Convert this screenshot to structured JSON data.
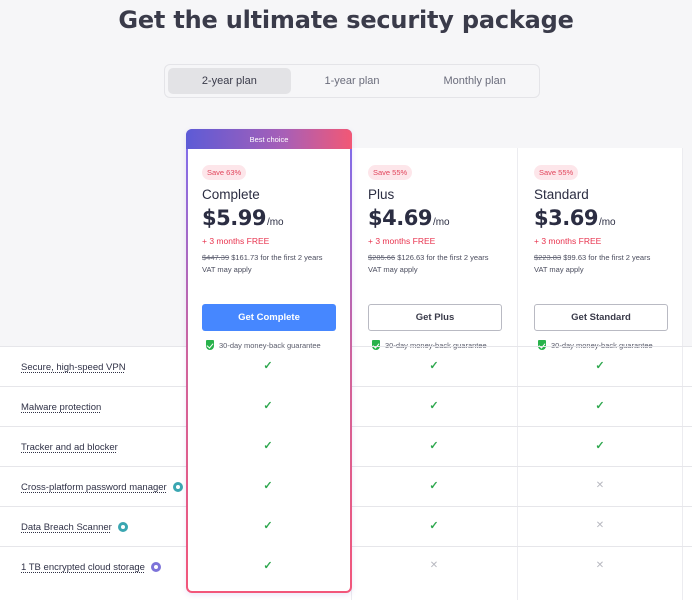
{
  "title": "Get the ultimate security package",
  "tabs": [
    {
      "label": "2-year plan",
      "active": true
    },
    {
      "label": "1-year plan",
      "active": false
    },
    {
      "label": "Monthly plan",
      "active": false
    }
  ],
  "plans": [
    {
      "banner": "Best choice",
      "save": "Save 63%",
      "name": "Complete",
      "price": "$5.99",
      "per": "/mo",
      "free": "+ 3 months FREE",
      "old_price": "$447.39",
      "new_price": "$161.73 for the first 2 years",
      "vat": "VAT may apply",
      "cta": "Get Complete",
      "guarantee": "30-day money-back guarantee"
    },
    {
      "save": "Save 55%",
      "name": "Plus",
      "price": "$4.69",
      "per": "/mo",
      "free": "+ 3 months FREE",
      "old_price": "$285.66",
      "new_price": "$126.63 for the first 2 years",
      "vat": "VAT may apply",
      "cta": "Get Plus",
      "guarantee": "30-day money-back guarantee"
    },
    {
      "save": "Save 55%",
      "name": "Standard",
      "price": "$3.69",
      "per": "/mo",
      "free": "+ 3 months FREE",
      "old_price": "$223.83",
      "new_price": "$99.63 for the first 2 years",
      "vat": "VAT may apply",
      "cta": "Get Standard",
      "guarantee": "30-day money-back guarantee"
    }
  ],
  "features": [
    {
      "label": "Secure, high-speed VPN",
      "info": false,
      "included": [
        true,
        true,
        true
      ]
    },
    {
      "label": "Malware protection",
      "info": false,
      "included": [
        true,
        true,
        true
      ]
    },
    {
      "label": "Tracker and ad blocker",
      "info": false,
      "included": [
        true,
        true,
        true
      ]
    },
    {
      "label": "Cross-platform password manager",
      "info": true,
      "info_color": "#3aa6b1",
      "included": [
        true,
        true,
        false
      ]
    },
    {
      "label": "Data Breach Scanner",
      "info": true,
      "info_color": "#3aa6b1",
      "included": [
        true,
        true,
        false
      ]
    },
    {
      "label": "1 TB encrypted cloud storage",
      "info": true,
      "info_color": "#7d73d9",
      "included": [
        true,
        false,
        false
      ]
    }
  ],
  "symbols": {
    "check": "✓",
    "cross": "✕"
  },
  "colors": {
    "primary_button": "#4687ff",
    "save_text": "#e1455c",
    "free_text": "#e8334e",
    "check": "#2fa84f",
    "shield": "#28b24b"
  }
}
